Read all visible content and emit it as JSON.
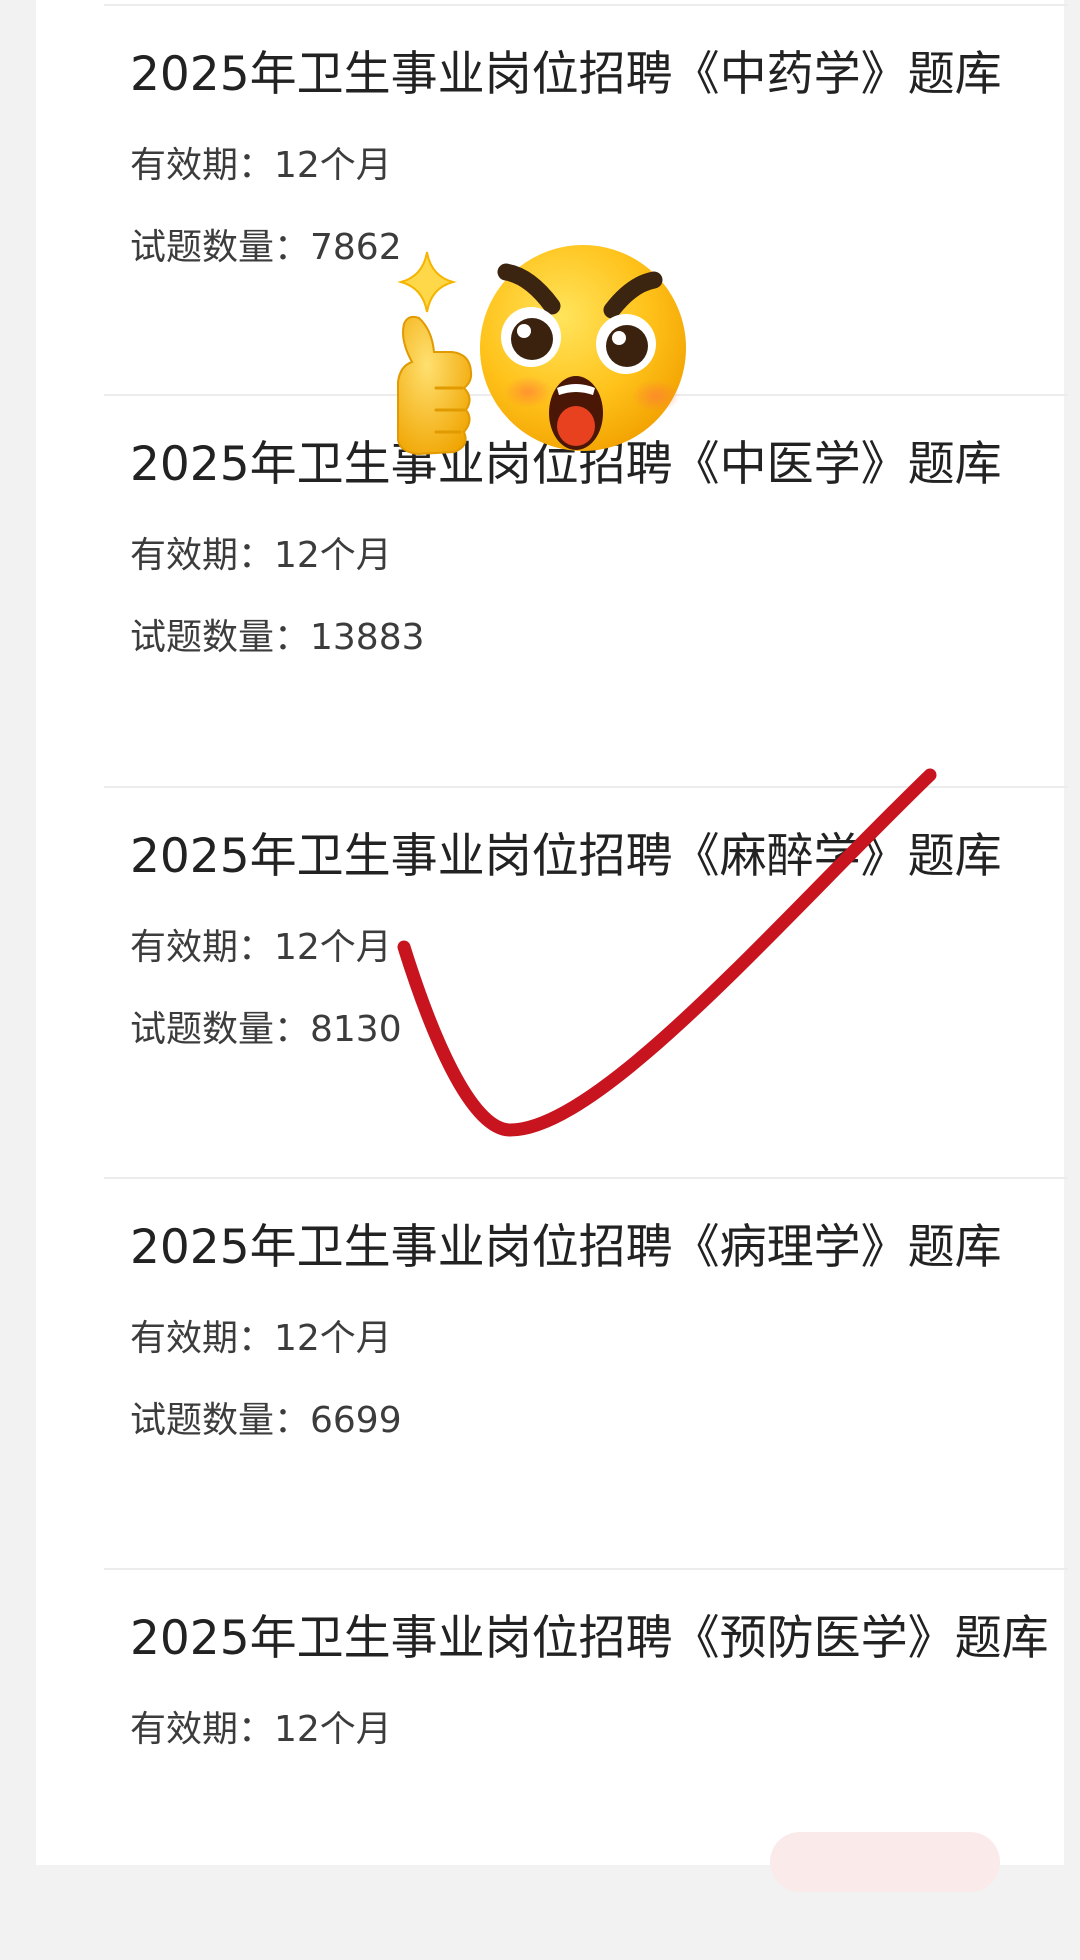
{
  "exam_list": {
    "items": [
      {
        "title": "2025年卫生事业岗位招聘《中药学》题库",
        "validity": "有效期：12个月",
        "question_count": "试题数量：7862"
      },
      {
        "title": "2025年卫生事业岗位招聘《中医学》题库",
        "validity": "有效期：12个月",
        "question_count": "试题数量：13883"
      },
      {
        "title": "2025年卫生事业岗位招聘《麻醉学》题库",
        "validity": "有效期：12个月",
        "question_count": "试题数量：8130"
      },
      {
        "title": "2025年卫生事业岗位招聘《病理学》题库",
        "validity": "有效期：12个月",
        "question_count": "试题数量：6699"
      },
      {
        "title": "2025年卫生事业岗位招聘《预防医学》题库",
        "validity": "有效期：12个月"
      }
    ]
  },
  "overlays": {
    "sticker": "thumbs-up-emoji-sticker-icon",
    "checkmark_color": "#c8141e"
  },
  "colors": {
    "background": "#f2f2f2",
    "card": "#ffffff",
    "divider": "#ececec",
    "text": "#222222"
  }
}
